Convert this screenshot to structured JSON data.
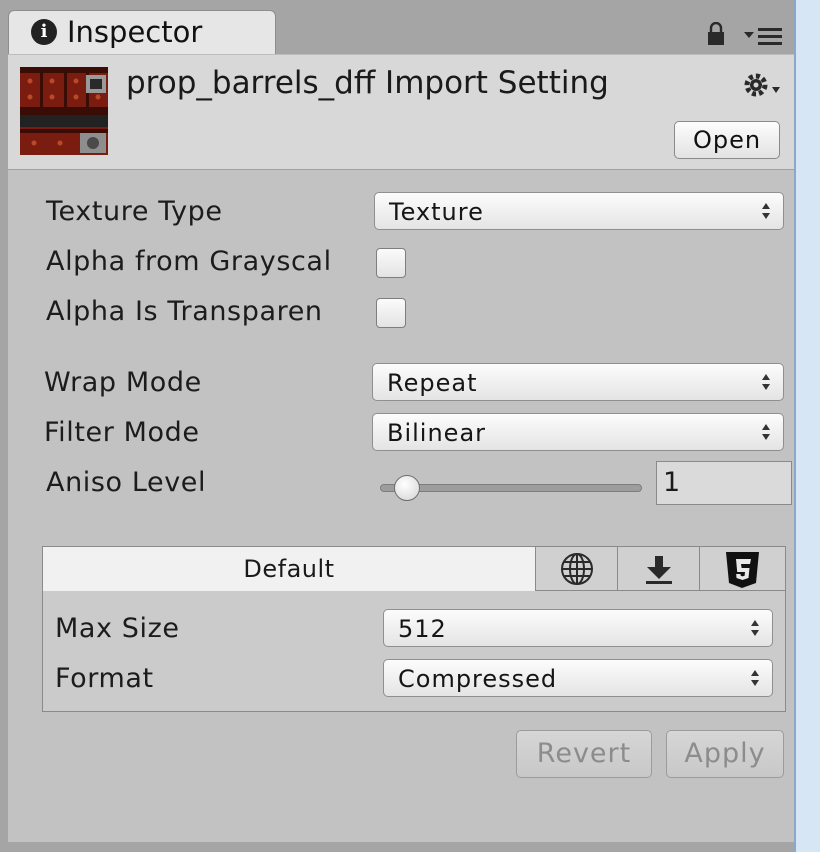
{
  "inspector": {
    "tab_title": "Inspector",
    "tab_icon": "info-icon",
    "header": {
      "title": "prop_barrels_dff Import Setting",
      "open_label": "Open",
      "gear_icon": "gear-icon"
    }
  },
  "texture": {
    "texture_type_label": "Texture Type",
    "texture_type_value": "Texture",
    "alpha_grayscale_label": "Alpha from Grayscal",
    "alpha_grayscale_checked": false,
    "alpha_transparent_label": "Alpha Is Transparen",
    "alpha_transparent_checked": false,
    "wrap_mode_label": "Wrap Mode",
    "wrap_mode_value": "Repeat",
    "filter_mode_label": "Filter Mode",
    "filter_mode_value": "Bilinear",
    "aniso_label": "Aniso Level",
    "aniso_value": "1",
    "aniso_slider_fraction": 0.1
  },
  "platforms": {
    "tabs": [
      {
        "label": "Default",
        "icon": "",
        "active": true
      },
      {
        "label": "",
        "icon": "globe-icon",
        "active": false
      },
      {
        "label": "",
        "icon": "download-icon",
        "active": false
      },
      {
        "label": "",
        "icon": "html5-icon",
        "active": false
      }
    ],
    "max_size_label": "Max Size",
    "max_size_value": "512",
    "format_label": "Format",
    "format_value": "Compressed"
  },
  "actions": {
    "revert_label": "Revert",
    "apply_label": "Apply"
  },
  "colors": {
    "panel_bg": "#c2c2c2",
    "header_bg": "#d8d8d8",
    "thumb_red": "#7a1c10"
  }
}
